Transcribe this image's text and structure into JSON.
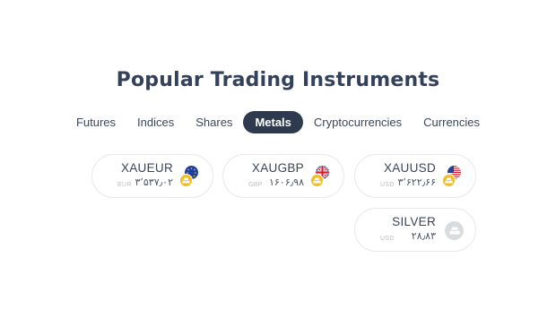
{
  "title": "Popular Trading Instruments",
  "tabs": [
    {
      "label": "Futures",
      "active": false
    },
    {
      "label": "Indices",
      "active": false
    },
    {
      "label": "Shares",
      "active": false
    },
    {
      "label": "Metals",
      "active": true
    },
    {
      "label": "Cryptocurrencies",
      "active": false
    },
    {
      "label": "Currencies",
      "active": false
    }
  ],
  "instruments": [
    {
      "symbol": "XAUEUR",
      "currency": "EUR",
      "price": "۳٬۵۳۷٫۰۲",
      "flag": "eu-flag-icon",
      "badge": "gold-bar-icon"
    },
    {
      "symbol": "XAUGBP",
      "currency": "GBP",
      "price": "۱۶۰۶٫۹۸",
      "flag": "uk-flag-icon",
      "badge": "gold-bar-icon"
    },
    {
      "symbol": "XAUUSD",
      "currency": "USD",
      "price": "۳٬۶۲۲٫۶۶",
      "flag": "us-flag-icon",
      "badge": "gold-bar-icon"
    },
    {
      "symbol": "SILVER",
      "currency": "USD",
      "price": "۲۸٫۸۳",
      "flag": "",
      "badge": "silver-bar-icon"
    }
  ],
  "colors": {
    "active_tab_bg": "#2e3b4e",
    "gold": "#f5bd1f",
    "silver": "#d9dcdf",
    "card_border": "#e6e8ec"
  }
}
